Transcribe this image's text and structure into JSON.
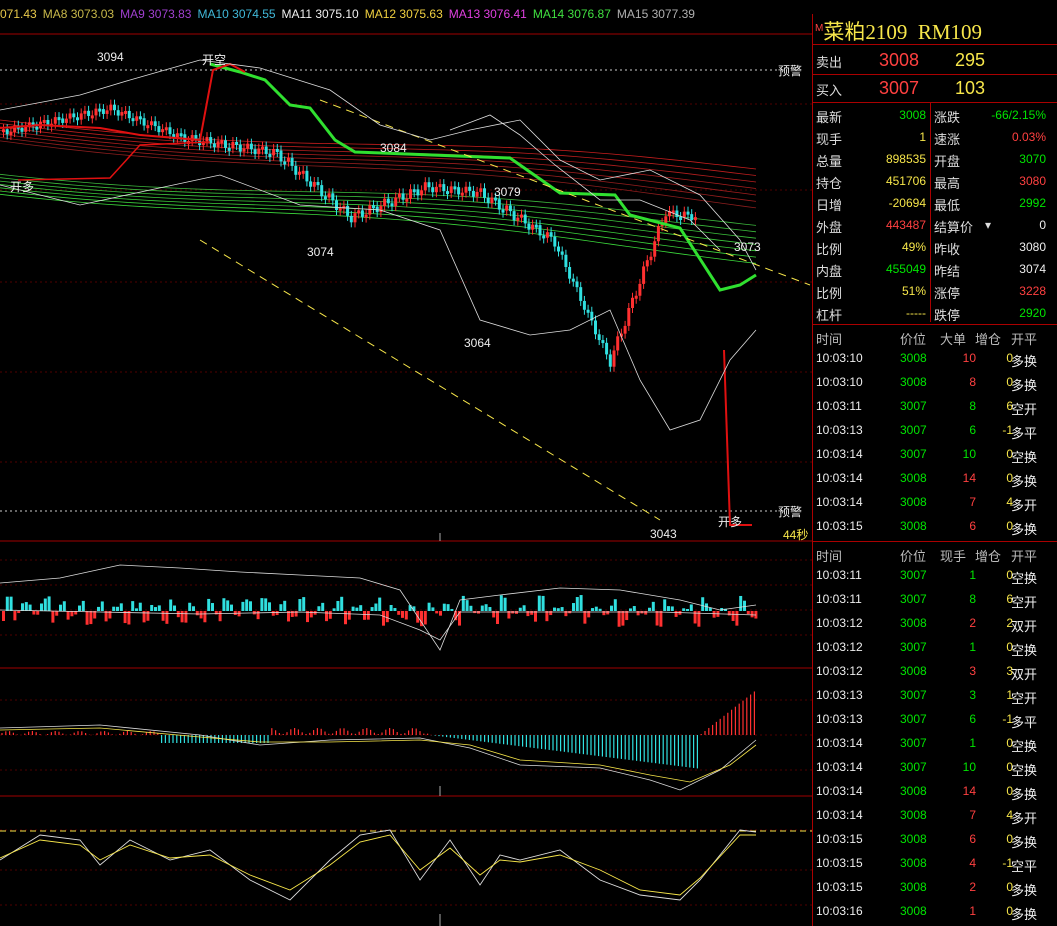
{
  "ma_legend": [
    {
      "label": "071.43",
      "color": "#e8c84a"
    },
    {
      "label": "MA8 3073.03",
      "color": "#c8b84a"
    },
    {
      "label": "MA9 3073.83",
      "color": "#a040d0"
    },
    {
      "label": "MA10 3074.55",
      "color": "#40b8d8"
    },
    {
      "label": "MA11 3075.10",
      "color": "#f0f0f0"
    },
    {
      "label": "MA12 3075.63",
      "color": "#f0d040"
    },
    {
      "label": "MA13 3076.41",
      "color": "#e040e0"
    },
    {
      "label": "MA14 3076.87",
      "color": "#40e040"
    },
    {
      "label": "MA15 3077.39",
      "color": "#b0b0b0"
    }
  ],
  "chart_annotations": {
    "price_3094": "3094",
    "open_short": "开空",
    "open_long_left": "开多",
    "price_3084": "3084",
    "price_3074": "3074",
    "price_3079": "3079",
    "price_3064": "3064",
    "price_3073": "3073",
    "price_3043": "3043",
    "open_long_right": "开多",
    "warn_top": "预警",
    "warn_bottom": "预警",
    "countdown": "44秒"
  },
  "quote": {
    "marker": "M",
    "name": "菜粕2109",
    "code": "RM109",
    "sell_label": "卖出",
    "sell_price": "3008",
    "sell_vol": "295",
    "buy_label": "买入",
    "buy_price": "3007",
    "buy_vol": "103"
  },
  "stats_left": [
    {
      "label": "最新",
      "value": "3008",
      "color": "#00e600"
    },
    {
      "label": "现手",
      "value": "1",
      "color": "#f7e64a"
    },
    {
      "label": "总量",
      "value": "898535",
      "color": "#f7e64a"
    },
    {
      "label": "持仓",
      "value": "451706",
      "color": "#f7e64a"
    },
    {
      "label": "日增",
      "value": "-20694",
      "color": "#f7e64a"
    },
    {
      "label": "外盘",
      "value": "443487",
      "color": "#ff4040"
    },
    {
      "label": "比例",
      "value": "49%",
      "color": "#f7e64a"
    },
    {
      "label": "内盘",
      "value": "455049",
      "color": "#00e600"
    },
    {
      "label": "比例",
      "value": "51%",
      "color": "#f7e64a"
    },
    {
      "label": "杠杆",
      "value": "-----",
      "color": "#f7e64a"
    }
  ],
  "stats_right": [
    {
      "label": "涨跌",
      "value": "-66/2.15%",
      "color": "#00e600"
    },
    {
      "label": "速涨",
      "value": "0.03%",
      "color": "#ff4040"
    },
    {
      "label": "开盘",
      "value": "3070",
      "color": "#00e600"
    },
    {
      "label": "最高",
      "value": "3080",
      "color": "#ff4040"
    },
    {
      "label": "最低",
      "value": "2992",
      "color": "#00e600"
    },
    {
      "label": "结算价",
      "value": "0",
      "color": "#eeeeee"
    },
    {
      "label": "昨收",
      "value": "3080",
      "color": "#eeeeee"
    },
    {
      "label": "昨结",
      "value": "3074",
      "color": "#eeeeee"
    },
    {
      "label": "涨停",
      "value": "3228",
      "color": "#ff4040"
    },
    {
      "label": "跌停",
      "value": "2920",
      "color": "#00e600"
    }
  ],
  "big_trades": {
    "headers": [
      "时间",
      "价位",
      "大单",
      "增仓",
      "开平"
    ],
    "rows": [
      {
        "time": "10:03:10",
        "price": "3008",
        "vol": "10",
        "chg": "0",
        "type": "多换",
        "vcolor": "#ff4040"
      },
      {
        "time": "10:03:10",
        "price": "3008",
        "vol": "8",
        "chg": "0",
        "type": "多换",
        "vcolor": "#ff4040"
      },
      {
        "time": "10:03:11",
        "price": "3007",
        "vol": "8",
        "chg": "6",
        "type": "空开",
        "vcolor": "#00e600"
      },
      {
        "time": "10:03:13",
        "price": "3007",
        "vol": "6",
        "chg": "-1",
        "type": "多平",
        "vcolor": "#00e600"
      },
      {
        "time": "10:03:14",
        "price": "3007",
        "vol": "10",
        "chg": "0",
        "type": "空换",
        "vcolor": "#00e600"
      },
      {
        "time": "10:03:14",
        "price": "3008",
        "vol": "14",
        "chg": "0",
        "type": "多换",
        "vcolor": "#ff4040"
      },
      {
        "time": "10:03:14",
        "price": "3008",
        "vol": "7",
        "chg": "4",
        "type": "多开",
        "vcolor": "#ff4040"
      },
      {
        "time": "10:03:15",
        "price": "3008",
        "vol": "6",
        "chg": "0",
        "type": "多换",
        "vcolor": "#ff4040"
      }
    ]
  },
  "ticks": {
    "headers": [
      "时间",
      "价位",
      "现手",
      "增仓",
      "开平"
    ],
    "rows": [
      {
        "time": "10:03:11",
        "price": "3007",
        "vol": "1",
        "chg": "0",
        "type": "空换",
        "vcolor": "#00e600"
      },
      {
        "time": "10:03:11",
        "price": "3007",
        "vol": "8",
        "chg": "6",
        "type": "空开",
        "vcolor": "#00e600"
      },
      {
        "time": "10:03:12",
        "price": "3008",
        "vol": "2",
        "chg": "2",
        "type": "双开",
        "vcolor": "#ff4040"
      },
      {
        "time": "10:03:12",
        "price": "3007",
        "vol": "1",
        "chg": "0",
        "type": "空换",
        "vcolor": "#00e600"
      },
      {
        "time": "10:03:12",
        "price": "3008",
        "vol": "3",
        "chg": "3",
        "type": "双开",
        "vcolor": "#ff4040"
      },
      {
        "time": "10:03:13",
        "price": "3007",
        "vol": "3",
        "chg": "1",
        "type": "空开",
        "vcolor": "#00e600"
      },
      {
        "time": "10:03:13",
        "price": "3007",
        "vol": "6",
        "chg": "-1",
        "type": "多平",
        "vcolor": "#00e600"
      },
      {
        "time": "10:03:14",
        "price": "3007",
        "vol": "1",
        "chg": "0",
        "type": "空换",
        "vcolor": "#00e600"
      },
      {
        "time": "10:03:14",
        "price": "3007",
        "vol": "10",
        "chg": "0",
        "type": "空换",
        "vcolor": "#00e600"
      },
      {
        "time": "10:03:14",
        "price": "3008",
        "vol": "14",
        "chg": "0",
        "type": "多换",
        "vcolor": "#ff4040"
      },
      {
        "time": "10:03:14",
        "price": "3008",
        "vol": "7",
        "chg": "4",
        "type": "多开",
        "vcolor": "#ff4040"
      },
      {
        "time": "10:03:15",
        "price": "3008",
        "vol": "6",
        "chg": "0",
        "type": "多换",
        "vcolor": "#ff4040"
      },
      {
        "time": "10:03:15",
        "price": "3008",
        "vol": "4",
        "chg": "-1",
        "type": "空平",
        "vcolor": "#ff4040"
      },
      {
        "time": "10:03:15",
        "price": "3008",
        "vol": "2",
        "chg": "0",
        "type": "多换",
        "vcolor": "#ff4040"
      },
      {
        "time": "10:03:16",
        "price": "3008",
        "vol": "1",
        "chg": "0",
        "type": "多换",
        "vcolor": "#ff4040"
      }
    ]
  },
  "colors": {
    "up": "#ff3030",
    "down": "#30e0e0",
    "grid": "#a00000",
    "text": "#dddddd"
  }
}
